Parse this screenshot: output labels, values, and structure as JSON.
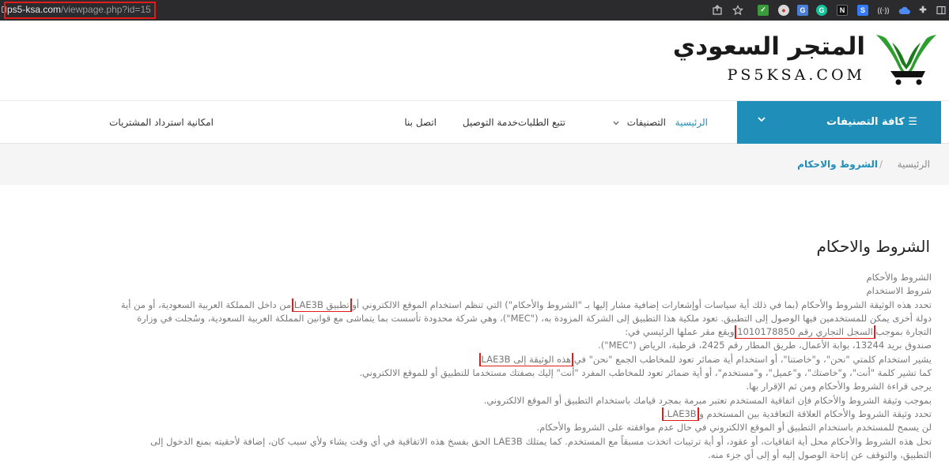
{
  "browser": {
    "url_host": "ps5-ksa.com",
    "url_path": "/viewpage.php?id=15"
  },
  "logo": {
    "arabic": "المتجر السعودي",
    "english": "PS5KSA.COM"
  },
  "nav": {
    "all_categories": "☰ كافة التصنيفات",
    "items": [
      {
        "label": "الرئيسية"
      },
      {
        "label": "التصنيفات"
      },
      {
        "label": "تتبع الطلبات"
      },
      {
        "label": "خدمة التوصيل"
      },
      {
        "label": "اتصل بنا"
      },
      {
        "label": "امكانية استرداد المشتريات"
      }
    ]
  },
  "breadcrumb": {
    "home": "الرئيسية",
    "separator": "/",
    "current": "الشروط والاحكام"
  },
  "page": {
    "title": "الشروط والاحكام",
    "lines": [
      {
        "text": "الشروط والأحكام"
      },
      {
        "text": "شروط الاستخدام"
      },
      {
        "pre": "تحدد هذه الوثيقة الشروط والأحكام (بما في ذلك أية سياسات أوإشعارات إضافية مشار إليها بـ \"الشروط والأحكام\") التي تنظم استخدام الموقع الالكتروني أو ",
        "hl": "تطبيق LAE3B",
        "post": " من داخل المملكة العربية السعودية، أو من أية"
      },
      {
        "text": "دولة أخرى يمكن للمستخدمين فيها الوصول إلى التطبيق. تعود ملكية هذا التطبيق إلى الشركة المزودة به، (\"MEC\")، وهي شركة محدودة تأسست بما يتماشى مع قوانين المملكة العربية السعودية، وسُجلت في وزارة"
      },
      {
        "pre": "التجارة بموجب ",
        "hl": "السجل التجاري رقم 1010178850",
        "post": " ويقع مقر عملها الرئيسي في:"
      },
      {
        "text": "صندوق بريد 13244، بوابة الأعمال، طريق المطار رقم 2425، قرطبة، الرياض (\"MEC\")."
      },
      {
        "pre": "يشير استخدام كلمتي \"نحن\"، و\"خاصتنا\"، أو استخدام أية ضمائر تعود للمخاطب الجمع \"نحن\" في ",
        "hl": "هذه الوثيقة إلى LAE3B",
        "post": ""
      },
      {
        "text": "كما تشير كلمة \"أنت\"، و\"خاصتك\"، و\"عميل\"، و\"مستخدم\"، أو أية ضمائر تعود للمخاطب المفرد \"أنت\" إليك بصفتك مستخدما للتطبيق أو للموقع الالكتروني."
      },
      {
        "text": "يرجى قراءة الشروط والأحكام ومن ثم الإقرار بها."
      },
      {
        "text": "بموجب وثيقة الشروط والأحكام فإن اتفاقية المستخدم تعتبر مبرمة بمجرد قيامك باستخدام التطبيق أو الموقع الالكتروني."
      },
      {
        "pre": "تحدد وثيقة الشروط والأحكام العلاقة التعاقدية بين المستخدم و ",
        "hl": "LAE3B.",
        "post": ""
      },
      {
        "text": "لن يسمح للمستخدم باستخدام التطبيق أو الموقع الالكتروني في حال عدم موافقته على الشروط والأحكام."
      },
      {
        "text": "تحل هذه الشروط والأحكام محل أية اتفاقيات، أو عقود، أو أية ترتيبات اتخذت مسبقاً مع المستخدم. كما يمتلك LAE3B الحق بفسخ هذه الاتفاقية في أي وقت يشاء ولأي سبب كان، إضافة لأحقيته بمنع الدخول إلى"
      },
      {
        "text": "التطبيق، والتوقف عن إتاحة الوصول إليه أو إلى أي جزء منه."
      }
    ]
  },
  "colors": {
    "accent": "#1f8eb9",
    "highlight": "#e21b1b",
    "logo_green": "#2e9e2e"
  }
}
